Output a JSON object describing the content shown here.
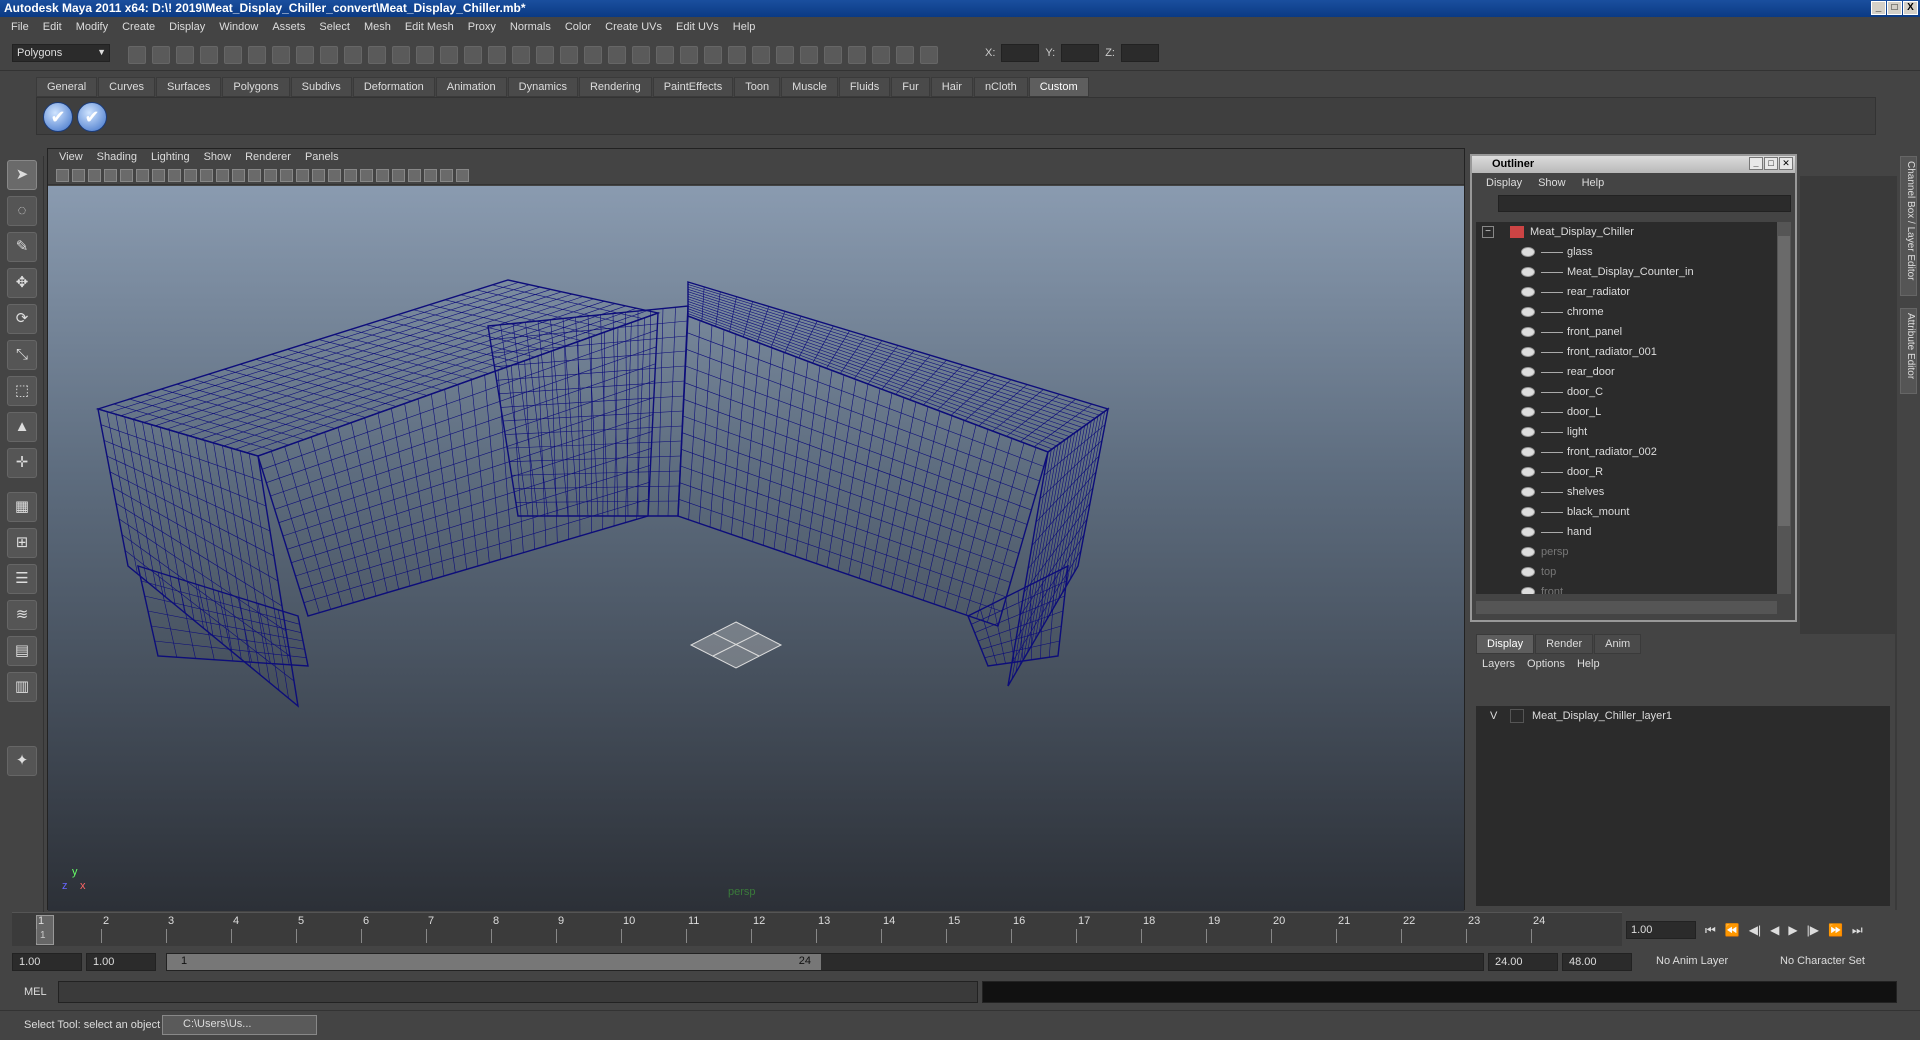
{
  "window": {
    "title": "Autodesk Maya 2011 x64: D:\\! 2019\\Meat_Display_Chiller_convert\\Meat_Display_Chiller.mb*",
    "minimize": "_",
    "maximize": "□",
    "close": "X"
  },
  "menu": [
    "File",
    "Edit",
    "Modify",
    "Create",
    "Display",
    "Window",
    "Assets",
    "Select",
    "Mesh",
    "Edit Mesh",
    "Proxy",
    "Normals",
    "Color",
    "Create UVs",
    "Edit UVs",
    "Help"
  ],
  "toolbar": {
    "mode": "Polygons",
    "x_label": "X:",
    "y_label": "Y:",
    "z_label": "Z:"
  },
  "shelf": {
    "tabs": [
      "General",
      "Curves",
      "Surfaces",
      "Polygons",
      "Subdivs",
      "Deformation",
      "Animation",
      "Dynamics",
      "Rendering",
      "PaintEffects",
      "Toon",
      "Muscle",
      "Fluids",
      "Fur",
      "Hair",
      "nCloth",
      "Custom"
    ],
    "active_tab": "Custom"
  },
  "viewport": {
    "menu": [
      "View",
      "Shading",
      "Lighting",
      "Show",
      "Renderer",
      "Panels"
    ],
    "camera_label": "persp",
    "axis_y": "y",
    "axis_x": "x",
    "axis_z": "z",
    "wire_color": "#0d0d7a"
  },
  "outliner": {
    "title": "Outliner",
    "menu": [
      "Display",
      "Show",
      "Help"
    ],
    "root": "Meat_Display_Chiller",
    "children": [
      "glass",
      "Meat_Display_Counter_in",
      "rear_radiator",
      "chrome",
      "front_panel",
      "front_radiator_001",
      "rear_door",
      "door_C",
      "door_L",
      "light",
      "front_radiator_002",
      "door_R",
      "shelves",
      "black_mount",
      "hand"
    ],
    "cameras": [
      "persp",
      "top",
      "front"
    ]
  },
  "side_tabs": {
    "channel": "Channel Box / Layer Editor",
    "attribute": "Attribute Editor"
  },
  "layers": {
    "tabs": [
      "Display",
      "Render",
      "Anim"
    ],
    "active_tab": "Display",
    "menu": [
      "Layers",
      "Options",
      "Help"
    ],
    "rows": [
      {
        "visible": "V",
        "name": "Meat_Display_Chiller_layer1"
      }
    ]
  },
  "timeline": {
    "ticks": [
      "1",
      "2",
      "3",
      "4",
      "5",
      "6",
      "7",
      "8",
      "9",
      "10",
      "11",
      "12",
      "13",
      "14",
      "15",
      "16",
      "17",
      "18",
      "19",
      "20",
      "21",
      "22",
      "23",
      "24"
    ],
    "current_frame": "1",
    "current_time": "1.00"
  },
  "range": {
    "start": "1.00",
    "playback_start": "1.00",
    "thumb_start": "1",
    "thumb_end": "24",
    "playback_end": "24.00",
    "end": "48.00",
    "anim_layer": "No Anim Layer",
    "char_set": "No Character Set"
  },
  "mel": {
    "label": "MEL"
  },
  "status": {
    "help": "Select Tool: select an object",
    "task": "C:\\Users\\Us..."
  }
}
